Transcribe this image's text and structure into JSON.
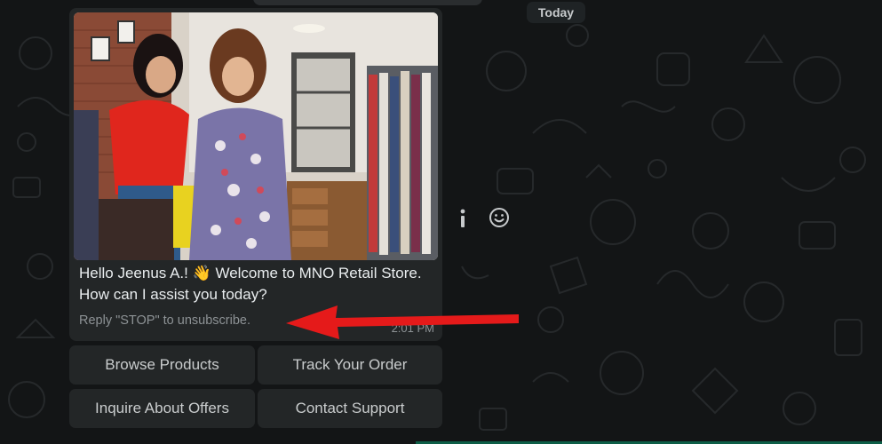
{
  "chat": {
    "date_chip": "Today"
  },
  "message": {
    "greeting": "Hello Jeenus A.! 👋 Welcome to MNO Retail Store. How can I assist you today?",
    "footer": "Reply \"STOP\" to unsubscribe.",
    "time": "2:01 PM"
  },
  "quick_replies": [
    {
      "label": "Browse Products"
    },
    {
      "label": "Track Your Order"
    },
    {
      "label": "Inquire About Offers"
    },
    {
      "label": "Contact Support"
    }
  ],
  "side_icons": [
    "info-icon",
    "emoji-icon"
  ],
  "colors": {
    "background": "#131516",
    "bubble": "#232627",
    "text": "#e9edef",
    "muted": "#8d9295",
    "annotation_arrow": "#e51a1a"
  }
}
